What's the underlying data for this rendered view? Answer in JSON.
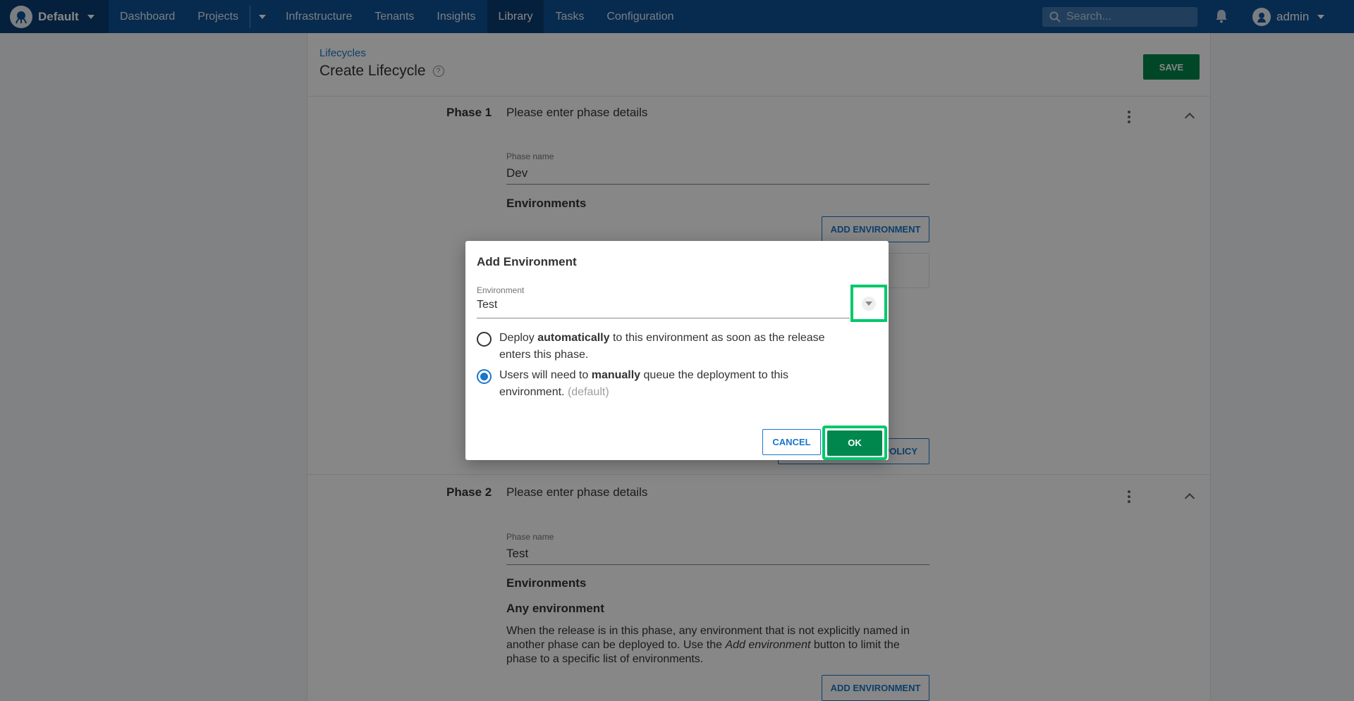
{
  "nav": {
    "space": "Default",
    "items": [
      "Dashboard",
      "Projects",
      "Infrastructure",
      "Tenants",
      "Insights",
      "Library",
      "Tasks",
      "Configuration"
    ],
    "active": "Library",
    "search_placeholder": "Search...",
    "user": "admin"
  },
  "page": {
    "breadcrumb": "Lifecycles",
    "title": "Create Lifecycle",
    "save_label": "SAVE"
  },
  "phases": [
    {
      "label": "Phase 1",
      "summary": "Please enter phase details",
      "name_label": "Phase name",
      "name_value": "Dev",
      "env_title": "Environments",
      "add_env_label": "ADD ENVIRONMENT",
      "policy_label": "POLICY"
    },
    {
      "label": "Phase 2",
      "summary": "Please enter phase details",
      "name_label": "Phase name",
      "name_value": "Test",
      "env_title": "Environments",
      "any_env_title": "Any environment",
      "any_env_text_1": "When the release is in this phase, any environment that is not explicitly named in another phase can be deployed to. Use the ",
      "any_env_text_em": "Add environment",
      "any_env_text_2": " button to limit the phase to a specific list of environments.",
      "add_env_label": "ADD ENVIRONMENT"
    }
  ],
  "dialog": {
    "title": "Add Environment",
    "env_label": "Environment",
    "env_value": "Test",
    "option_auto": {
      "pre": "Deploy ",
      "bold": "automatically",
      "post": " to this environment as soon as the release enters this phase.",
      "checked": false
    },
    "option_manual": {
      "pre": "Users will need to ",
      "bold": "manually",
      "post": " queue the deployment to this environment.",
      "suffix": "(default)",
      "checked": true
    },
    "cancel_label": "CANCEL",
    "ok_label": "OK"
  },
  "colors": {
    "nav_bg": "#0f5296",
    "primary": "#1a77ca",
    "success": "#00874d",
    "highlight": "#00c86b"
  }
}
